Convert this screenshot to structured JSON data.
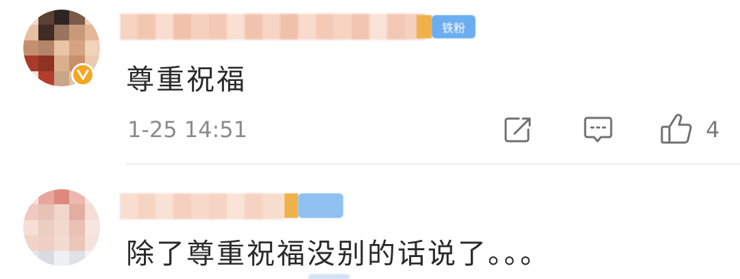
{
  "comments": [
    {
      "text": "尊重祝福",
      "timestamp": "1-25 14:51",
      "fan_badge": "铁粉",
      "verified_badge": "V",
      "actions": {
        "share_icon": "share-icon",
        "reply_icon": "comment-icon",
        "like_icon": "thumbs-up-icon",
        "like_count": "4"
      }
    },
    {
      "text": "除了尊重祝福没别的话说了。。。"
    }
  ],
  "colors": {
    "text": "#2a2a2a",
    "meta": "#8a8a8a",
    "verified": "#f5a623",
    "fan_badge": "#6aaef0",
    "divider": "#ececec"
  }
}
